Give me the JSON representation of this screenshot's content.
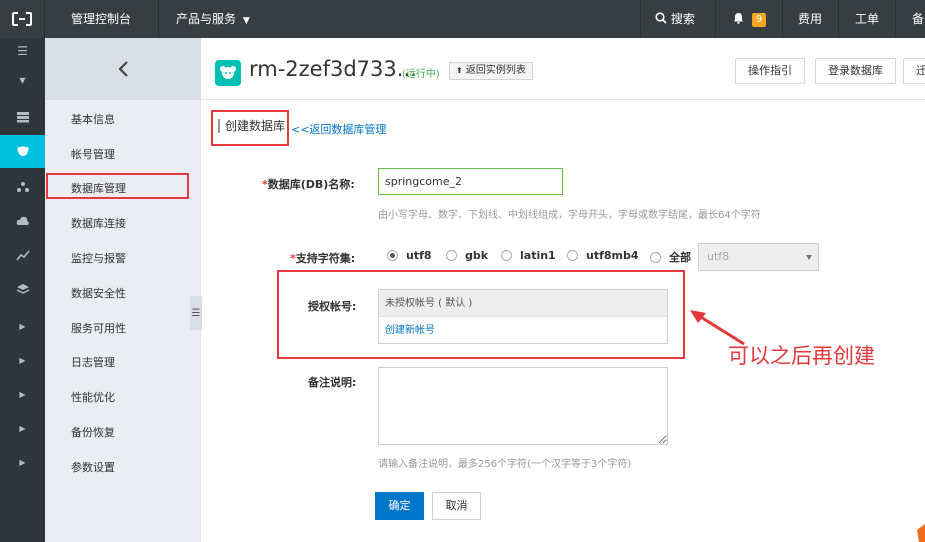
{
  "topbar": {
    "console": "管理控制台",
    "products": "产品与服务",
    "search": "搜索",
    "bell_count": "9",
    "billing": "费用",
    "tickets": "工单",
    "backup": "备"
  },
  "sidebar": {
    "items": [
      {
        "label": "基本信息"
      },
      {
        "label": "帐号管理"
      },
      {
        "label": "数据库管理"
      },
      {
        "label": "数据库连接"
      },
      {
        "label": "监控与报警"
      },
      {
        "label": "数据安全性"
      },
      {
        "label": "服务可用性"
      },
      {
        "label": "日志管理"
      },
      {
        "label": "性能优化"
      },
      {
        "label": "备份恢复"
      },
      {
        "label": "参数设置"
      }
    ]
  },
  "header": {
    "instance_name": "rm-2zef3d733...",
    "status": "(运行中)",
    "back_to_list": "返回实例列表",
    "btn_guide": "操作指引",
    "btn_login_db": "登录数据库",
    "btn_migrate": "迁"
  },
  "form": {
    "title": "创建数据库",
    "back_link": "<<返回数据库管理",
    "db_name_label": "数据库(DB)名称:",
    "db_name_value": "springcome_2",
    "db_name_hint": "由小写字母、数字、下划线、中划线组成，字母开头，字母或数字结尾，最长64个字符",
    "charset_label": "支持字符集:",
    "charsets": [
      {
        "label": "utf8",
        "checked": true
      },
      {
        "label": "gbk",
        "checked": false
      },
      {
        "label": "latin1",
        "checked": false
      },
      {
        "label": "utf8mb4",
        "checked": false
      },
      {
        "label": "全部",
        "checked": false
      }
    ],
    "charset_select_value": "utf8",
    "account_label": "授权帐号:",
    "account_unassigned": "未授权帐号 ( 默认 )",
    "account_create": "创建新帐号",
    "notes_label": "备注说明:",
    "notes_hint": "请输入备注说明，最多256个字符(一个汉字等于3个字符)",
    "ok": "确定",
    "cancel": "取消"
  },
  "annotation": {
    "text": "可以之后再创建",
    "color": "#e4393c"
  },
  "colors": {
    "topbar": "#373d41",
    "active_icon": "#00c1de",
    "primary": "#0077c8",
    "link": "#0073c6",
    "status_green": "#4caf50"
  }
}
